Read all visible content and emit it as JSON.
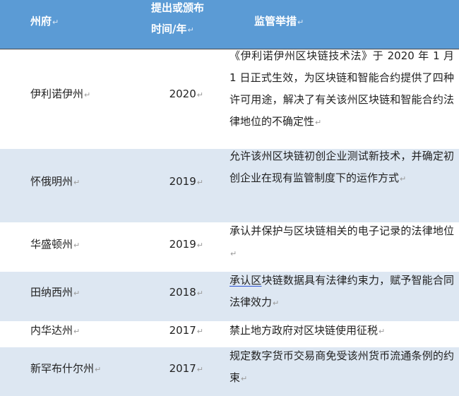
{
  "marks": {
    "para": "↵"
  },
  "header": {
    "state": "州府",
    "year_line1": "提出或颁布",
    "year_line2": "时间/年",
    "measures": "监管举措"
  },
  "rows": [
    {
      "state": "伊利诺伊州",
      "year": "2020",
      "measure": "《伊利诺伊州区块链技术法》于 2020 年 1 月 1 日正式生效，为区块链和智能合约提供了四种许可用途，解决了有关该州区块链和智能合约法律地位的不确定性"
    },
    {
      "state": "怀俄明州",
      "year": "2019",
      "measure": "允许该州区块链初创企业测试新技术，并确定初创企业在现有监管制度下的运作方式"
    },
    {
      "state": "华盛顿州",
      "year": "2019",
      "measure": "承认并保护与区块链相关的电子记录的法律地位"
    },
    {
      "state": "田纳西州",
      "year": "2018",
      "measure_underlined": "承认区",
      "measure": "块链数据具有法律约束力，赋予智能合同法律效力"
    },
    {
      "state": "内华达州",
      "year": "2017",
      "measure": "禁止地方政府对区块链使用征税"
    },
    {
      "state": "新罕布什尔州",
      "year": "2017",
      "measure": "规定数字货币交易商免受该州货币流通条例的约束"
    }
  ]
}
